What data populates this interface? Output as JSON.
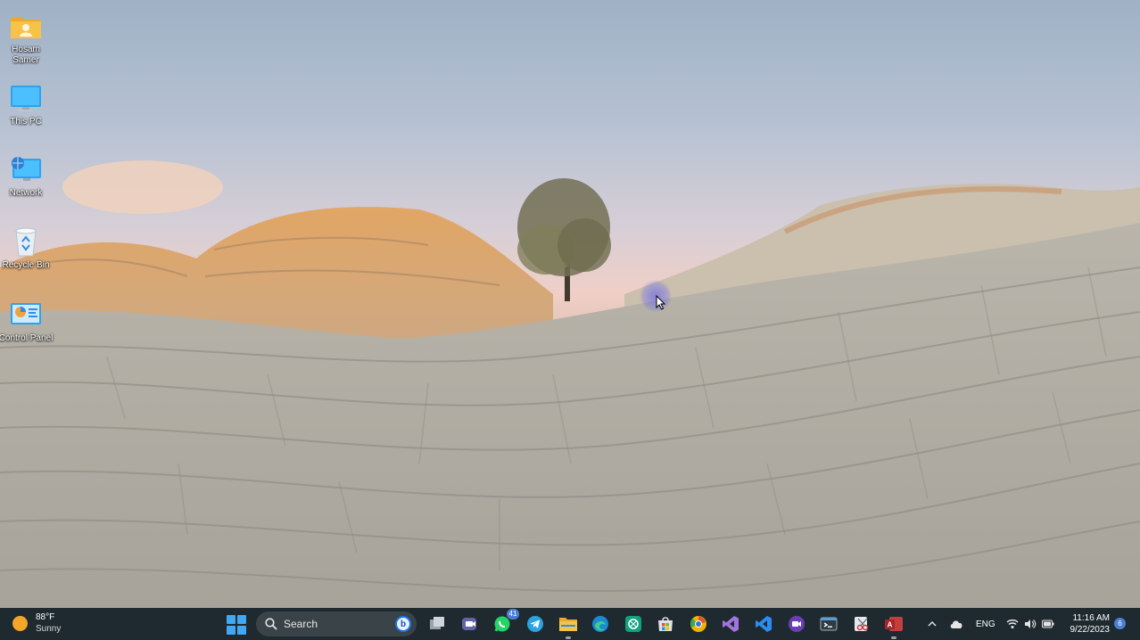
{
  "desktop_icons": [
    {
      "label": "Hosam\nSamer",
      "icon": "user-folder-icon"
    },
    {
      "label": "This PC",
      "icon": "monitor-icon"
    },
    {
      "label": "Network",
      "icon": "network-icon"
    },
    {
      "label": "Recycle Bin",
      "icon": "recycle-bin-icon"
    },
    {
      "label": "Control Panel",
      "icon": "control-panel-icon"
    }
  ],
  "taskbar": {
    "weather": {
      "temp": "88°F",
      "condition": "Sunny"
    },
    "search": {
      "placeholder": "Search"
    },
    "apps": [
      {
        "name": "task-view"
      },
      {
        "name": "teams"
      },
      {
        "name": "whatsapp",
        "badge": "41"
      },
      {
        "name": "telegram"
      },
      {
        "name": "file-explorer"
      },
      {
        "name": "edge"
      },
      {
        "name": "chatgpt"
      },
      {
        "name": "microsoft-store"
      },
      {
        "name": "chrome-canary"
      },
      {
        "name": "visual-studio"
      },
      {
        "name": "vs-code"
      },
      {
        "name": "screen-recorder"
      },
      {
        "name": "terminal"
      },
      {
        "name": "snipping-tool"
      },
      {
        "name": "access"
      }
    ],
    "tray": {
      "language": "ENG",
      "time": "11:16 AM",
      "date": "9/22/2023",
      "notifications": "6"
    }
  },
  "colors": {
    "taskbar_bg": "#1f2a30",
    "accent": "#3fa9f5"
  }
}
